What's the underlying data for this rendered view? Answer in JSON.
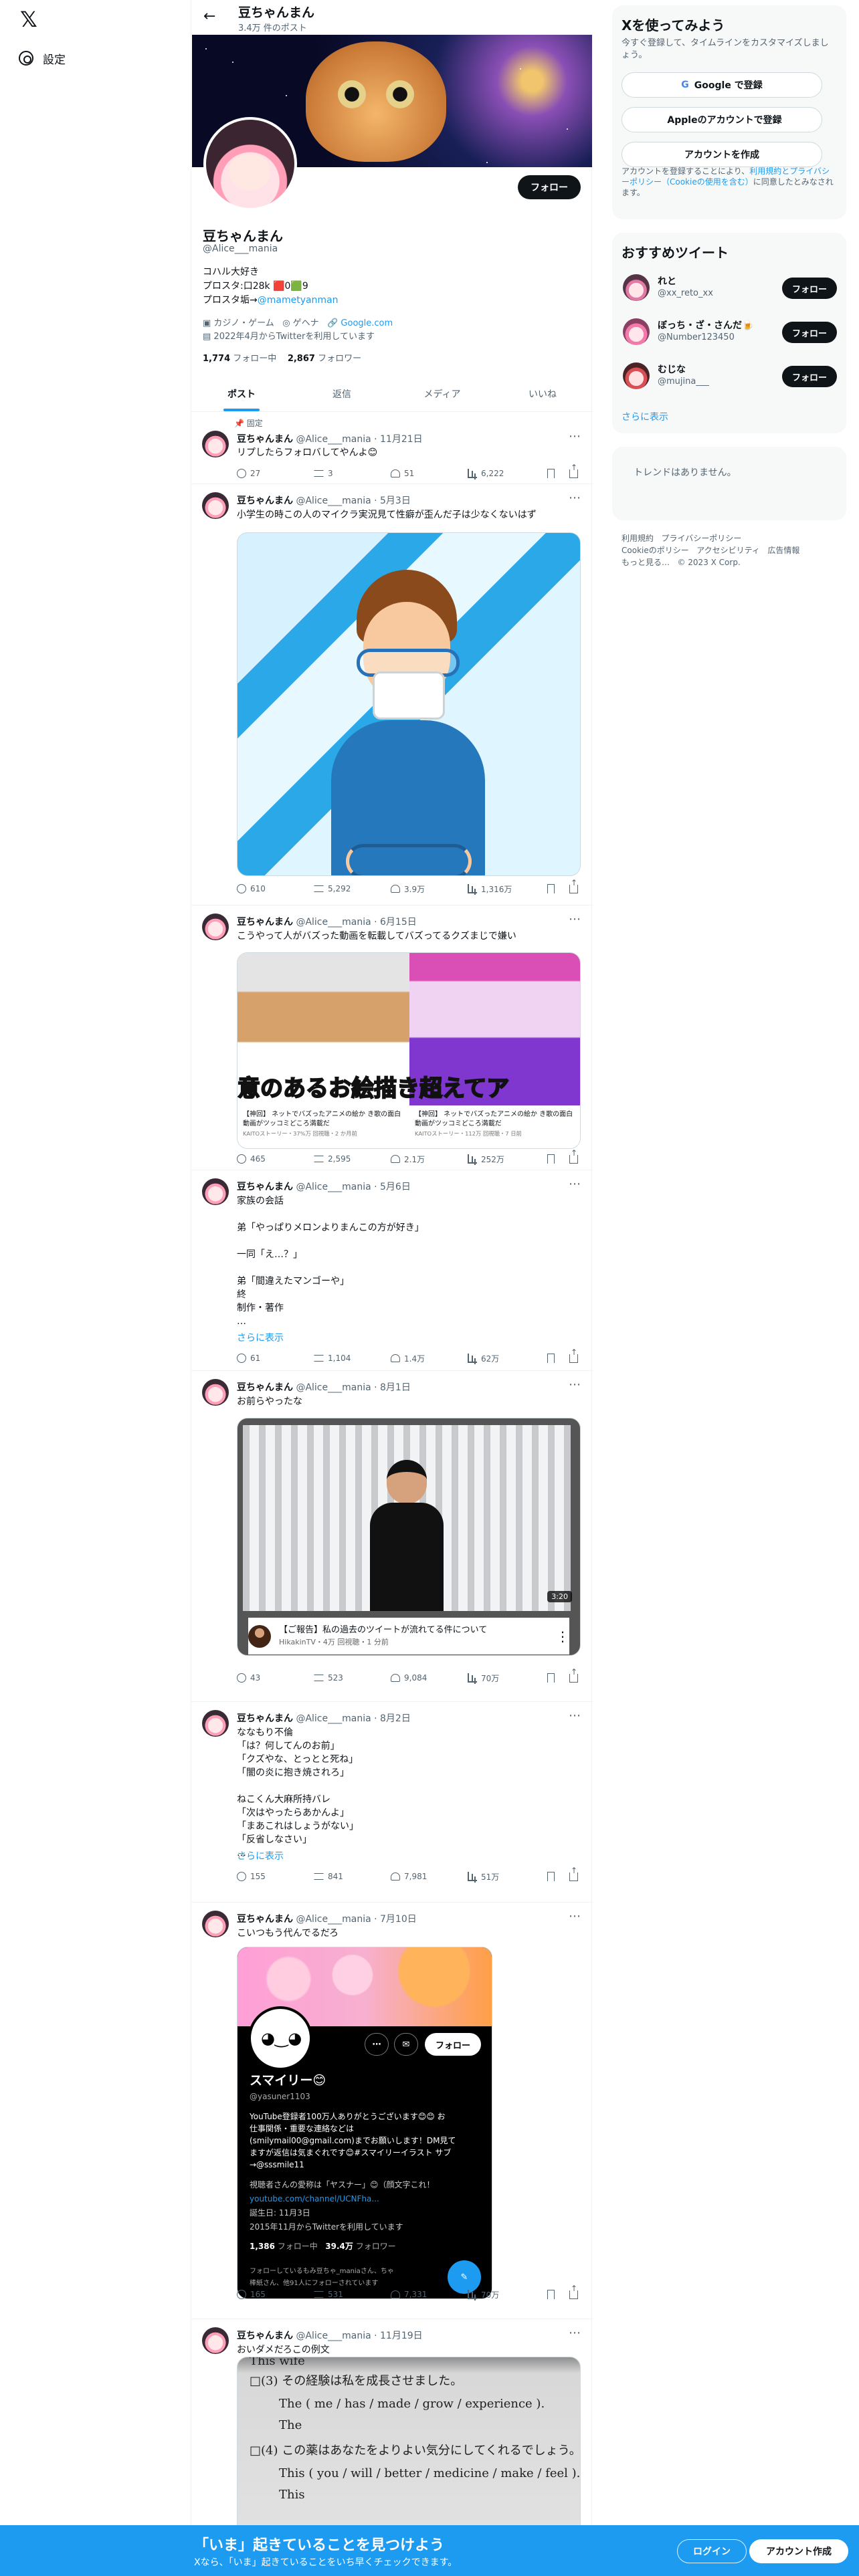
{
  "app": {
    "logo": "𝕏",
    "settings_label": "設定"
  },
  "profile": {
    "top_name": "豆ちゃんまん",
    "top_count": "3.4万 件のポスト",
    "name": "豆ちゃんまん",
    "handle": "@Alice___mania",
    "follow_label": "フォロー",
    "bio": [
      "コハル大好き",
      "プロスタ:口28k 🟥0🟩9",
      "プロスタ垢→"
    ],
    "bio_link": "@mametyanman",
    "category": "カジノ・ゲーム",
    "location": "ゲヘナ",
    "website": "Google.com",
    "joined": "2022年4月からTwitterを利用しています",
    "following_count": "1,774",
    "following_label": "フォロー中",
    "followers_count": "2,867",
    "followers_label": "フォロワー"
  },
  "tabs": [
    "ポスト",
    "返信",
    "メディア",
    "いいね"
  ],
  "tweets": [
    {
      "pinned": "固定",
      "name": "豆ちゃんまん",
      "meta": "@Alice___mania · 11月21日",
      "text": "リプしたらフォロバしてやんよ😊",
      "stats": [
        "27",
        "3",
        "51",
        "6,222"
      ]
    },
    {
      "name": "豆ちゃんまん",
      "meta": "@Alice___mania · 5月3日",
      "text": "小学生の時この人のマイクラ実況見て性癖が歪んだ子は少なくないはず",
      "stats": [
        "610",
        "5,292",
        "3.9万",
        "1,316万"
      ]
    },
    {
      "name": "豆ちゃんまん",
      "meta": "@Alice___mania · 6月15日",
      "text": "こうやって人がバズった動画を転載してバズってるクズまじで嫌い",
      "caption_text": "意のあるお絵描き超えてア",
      "caption1": "【神回】 ネットでバズったアニメの絵か\nき歌の面白動画がツッコミどころ満載だ",
      "caption1_meta": "KAITOストーリー・37%万 回視聴・2 か月前",
      "caption2": "【神回】 ネットでバズったアニメの絵か\nき歌の面白動画がツッコミどころ満載だ",
      "caption2_meta": "KAITOストーリー・112万 回視聴・7 日前",
      "stats": [
        "465",
        "2,595",
        "2.1万",
        "252万"
      ]
    },
    {
      "name": "豆ちゃんまん",
      "meta": "@Alice___mania · 5月6日",
      "text": "家族の会話\n\n弟「やっぱりメロンよりまんこの方が好き」\n\n一同「え…？」\n\n弟「間違えたマンゴーや」\n終\n制作・著作\n…",
      "show_more": "さらに表示",
      "stats": [
        "61",
        "1,104",
        "1.4万",
        "62万"
      ]
    },
    {
      "name": "豆ちゃんまん",
      "meta": "@Alice___mania · 8月1日",
      "text": "お前らやったな",
      "duration": "3:20",
      "video_title": "【ご報告】私の過去のツイートが流れてる件について",
      "video_meta": "HikakinTV・4万 回視聴・1 分前",
      "stats": [
        "43",
        "523",
        "9,084",
        "70万"
      ]
    },
    {
      "name": "豆ちゃんまん",
      "meta": "@Alice___mania · 8月2日",
      "text": "ななもり不倫\n「は？何してんのお前」\n「クズやな、とっとと死ね」\n「闇の炎に抱き焼されろ」\n\nねこくん大麻所持バレ\n「次はやったらあかんよ」\n「まあこれはしょうがない」\n「反省しなさい」\n…",
      "show_more": "さらに表示",
      "stats": [
        "155",
        "841",
        "7,981",
        "51万"
      ]
    },
    {
      "name": "豆ちゃんまん",
      "meta": "@Alice___mania · 7月10日",
      "text": "こいつもう代んでるだろ",
      "embed": {
        "name": "スマイリー😊",
        "handle": "@yasuner1103",
        "follow": "フォロー",
        "bio": "YouTube登録者100万人ありがとうございます😊😊 お\n仕事関係・重要な連絡などは\n(smilymail00@gmail.com)までお願いします！DM見て\nますが返信は気まぐれです😊#スマイリーイラスト サブ\n→@sssmile11",
        "location": "視聴者さんの愛称は「ヤスナー」😊（顔文字これ！",
        "link": "youtube.com/channel/UCNFha...",
        "birth": "誕生日: 11月3日",
        "joined": "2015年11月からTwitterを利用しています",
        "following": "1,386",
        "following_label": "フォロー中",
        "followers": "39.4万",
        "followers_label": "フォロワー",
        "notice": "フォローしているもみ豆ちゃ_maniaさん、ちゃ\n棒紙さん、他91人にフォローされています"
      },
      "stats": [
        "165",
        "531",
        "7,331",
        "70万"
      ]
    },
    {
      "name": "豆ちゃんまん",
      "meta": "@Alice___mania · 11月19日",
      "text": "おいダメだろこの例文",
      "exam_lines": [
        "This wife",
        "□(3)  その経験は私を成長させました。",
        "The ( me / has / made / grow / experience ).",
        "The",
        "□(4)  この薬はあなたをよりよい気分にしてくれるでしょう。",
        "This ( you / will / better / medicine / make / feel ).",
        "This"
      ]
    }
  ],
  "sidebar": {
    "signup_title": "Xを使ってみよう",
    "signup_desc": "今すぐ登録して、タイムラインをカスタマイズしましょう。",
    "google_btn": "Google で登録",
    "apple_btn": "Appleのアカウントで登録",
    "create_btn": "アカウントを作成",
    "terms_prefix": "アカウントを登録することにより、",
    "terms_link": "利用規約とプライバシーポリシー（Cookieの使用を含む）",
    "terms_suffix": "に同意したとみなされます。",
    "recommend_title": "おすすめツイート",
    "recommend": [
      {
        "name": "れと",
        "handle": "@xx_reto_xx",
        "follow": "フォロー"
      },
      {
        "name": "ぼっち・ざ・さんだ🍺",
        "handle": "@Number123450",
        "follow": "フォロー"
      },
      {
        "name": "むじな",
        "handle": "@mujina___",
        "follow": "フォロー"
      }
    ],
    "show_more": "さらに表示",
    "trends_empty": "トレンドはありません。",
    "footer": [
      "利用規約",
      "プライバシーポリシー",
      "Cookieのポリシー",
      "アクセシビリティ",
      "広告情報",
      "もっと見る…",
      "© 2023 X Corp."
    ]
  },
  "bottom": {
    "title": "「いま」起きていることを見つけよう",
    "subtitle": "Xなら、「いま」起きていることをいち早くチェックできます。",
    "login": "ログイン",
    "signup": "アカウント作成"
  }
}
